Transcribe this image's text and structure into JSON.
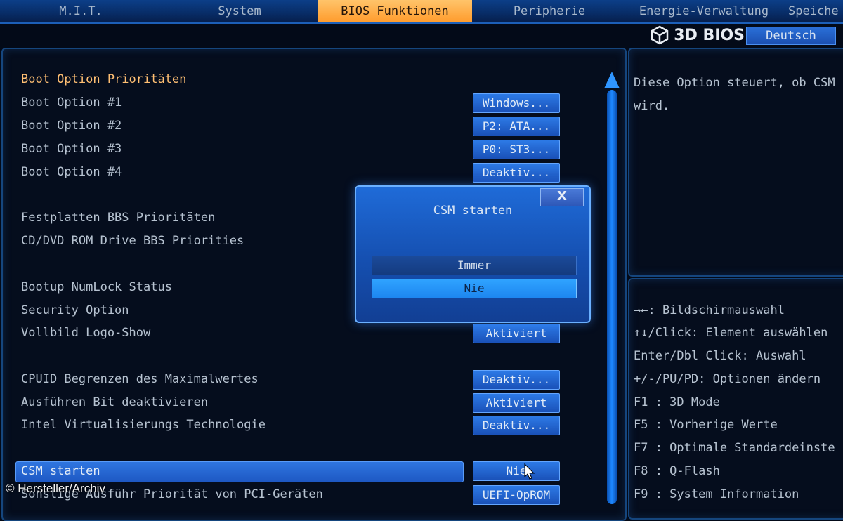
{
  "tabs": [
    {
      "label": "M.I.T.",
      "active": false
    },
    {
      "label": "System",
      "active": false
    },
    {
      "label": "BIOS Funktionen",
      "active": true
    },
    {
      "label": "Peripherie",
      "active": false
    },
    {
      "label": "Energie-Verwaltung",
      "active": false
    },
    {
      "label": "Speiche",
      "active": false
    }
  ],
  "brand": {
    "text": "3D BIOS",
    "icon": "cube-logo-icon"
  },
  "language_button": "Deutsch",
  "settings": {
    "header": "Boot Option Prioritäten",
    "boot1": {
      "label": "Boot Option #1",
      "value": "Windows..."
    },
    "boot2": {
      "label": "Boot Option #2",
      "value": "P2: ATA..."
    },
    "boot3": {
      "label": "Boot Option #3",
      "value": "P0: ST3..."
    },
    "boot4": {
      "label": "Boot Option #4",
      "value": "Deaktiv..."
    },
    "hdd_bbs": "Festplatten BBS Prioritäten",
    "cd_bbs": "CD/DVD ROM Drive BBS Priorities",
    "numlock": "Bootup NumLock Status",
    "security": "Security Option",
    "logo": {
      "label": "Vollbild Logo-Show",
      "value": "Aktiviert"
    },
    "cpuid": {
      "label": "CPUID Begrenzen des Maximalwertes",
      "value": "Deaktiv..."
    },
    "xd_bit": {
      "label": "Ausführen Bit deaktivieren",
      "value": "Aktiviert"
    },
    "vt": {
      "label": "Intel Virtualisierungs Technologie",
      "value": "Deaktiv..."
    },
    "csm": {
      "label": "CSM starten",
      "value": "Nie"
    },
    "pci": {
      "label": "Sonstige Ausführ Priorität von PCI-Geräten",
      "value": "UEFI-OpROM"
    }
  },
  "help": {
    "text": "Diese Option steuert, ob CSM wird."
  },
  "keys": [
    "→←: Bildschirmauswahl",
    "↑↓/Click: Element auswählen",
    "Enter/Dbl Click: Auswahl",
    "+/-/PU/PD: Optionen ändern",
    "F1  : 3D Mode",
    "F5  : Vorherige Werte",
    "F7  : Optimale Standardeinste",
    "F8  : Q-Flash",
    "F9  : System Information"
  ],
  "dialog": {
    "title": "CSM starten",
    "close": "X",
    "options": [
      "Immer",
      "Nie"
    ],
    "selected": "Nie"
  },
  "watermark": "© Hersteller/Archiv"
}
